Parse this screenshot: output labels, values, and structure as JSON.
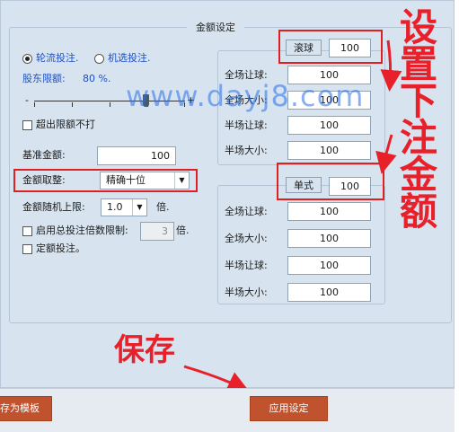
{
  "group_title": "金额设定",
  "mode": {
    "radio1": "轮流投注.",
    "radio2": "机选投注."
  },
  "shareholder": {
    "label": "股东限额:",
    "value": "80 %."
  },
  "slider": {
    "minus": "-",
    "plus": "+",
    "level_percent": 80
  },
  "exceed_limit": "超出限额不打",
  "base_amount": {
    "label": "基准金额:",
    "value": "100"
  },
  "rounding": {
    "label": "金额取整:",
    "selected": "精确十位"
  },
  "random_limit": {
    "label": "金额随机上限:",
    "selected": "1.0",
    "unit": "倍."
  },
  "total_multiple": {
    "label": "启用总投注倍数限制:",
    "value": "3",
    "unit": "倍."
  },
  "fixed_bet": "定额投注。",
  "live": {
    "title": "滚球",
    "value": "100",
    "rows": [
      {
        "label": "全场让球:",
        "value": "100"
      },
      {
        "label": "全场大小:",
        "value": "100"
      },
      {
        "label": "半场让球:",
        "value": "100"
      },
      {
        "label": "半场大小:",
        "value": "100"
      }
    ]
  },
  "single": {
    "title": "单式",
    "value": "100",
    "rows": [
      {
        "label": "全场让球:",
        "value": "100"
      },
      {
        "label": "全场大小:",
        "value": "100"
      },
      {
        "label": "半场让球:",
        "value": "100"
      },
      {
        "label": "半场大小:",
        "value": "100"
      }
    ]
  },
  "buttons": {
    "save_template": "存为模板",
    "apply": "应用设定"
  },
  "annotations": {
    "set_bet": "设置下注金额",
    "save": "保存"
  },
  "watermark": "www.dayj8.com",
  "colors": {
    "panel": "#d7e4f0",
    "button": "#c0532e",
    "annotation_red": "#e8202a",
    "watermark": "#286ee6"
  }
}
